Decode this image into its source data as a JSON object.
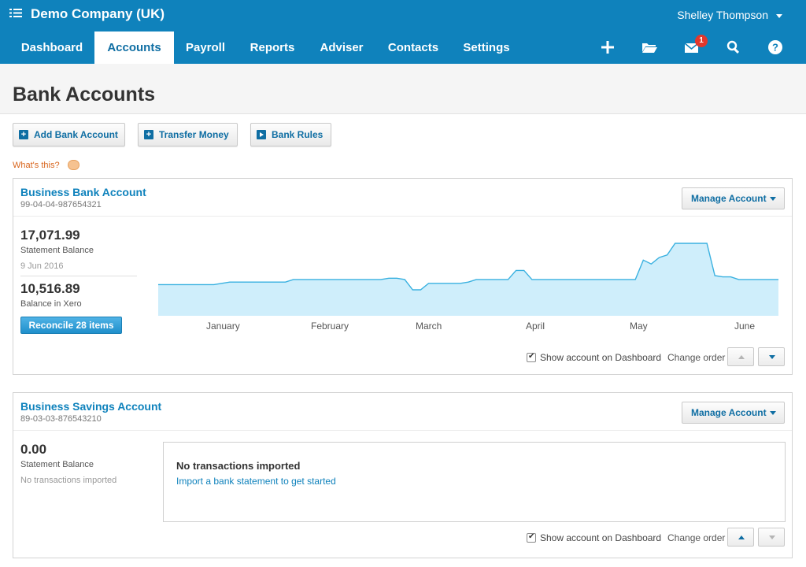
{
  "header": {
    "org_name": "Demo Company (UK)",
    "user_name": "Shelley Thompson",
    "notification_count": "1"
  },
  "nav": {
    "tabs": [
      {
        "label": "Dashboard",
        "active": false
      },
      {
        "label": "Accounts",
        "active": true
      },
      {
        "label": "Payroll",
        "active": false
      },
      {
        "label": "Reports",
        "active": false
      },
      {
        "label": "Adviser",
        "active": false
      },
      {
        "label": "Contacts",
        "active": false
      },
      {
        "label": "Settings",
        "active": false
      }
    ],
    "icons": [
      "plus-icon",
      "folder-icon",
      "mail-icon",
      "search-icon",
      "help-icon"
    ]
  },
  "page": {
    "title": "Bank Accounts",
    "actions": {
      "add_bank_account": "Add Bank Account",
      "transfer_money": "Transfer Money",
      "bank_rules": "Bank Rules"
    },
    "whats_this": "What's this?"
  },
  "accounts": [
    {
      "name": "Business Bank Account",
      "number": "99-04-04-987654321",
      "manage_label": "Manage Account",
      "statement_balance": "17,071.99",
      "statement_balance_label": "Statement Balance",
      "statement_date": "9 Jun 2016",
      "xero_balance": "10,516.89",
      "xero_balance_label": "Balance in Xero",
      "reconcile_label": "Reconcile 28 items",
      "show_on_dashboard": "Show account on Dashboard",
      "show_checked": true,
      "change_order": "Change order",
      "months": [
        "January",
        "February",
        "March",
        "April",
        "May",
        "June"
      ]
    },
    {
      "name": "Business Savings Account",
      "number": "89-03-03-876543210",
      "manage_label": "Manage Account",
      "statement_balance": "0.00",
      "statement_balance_label": "Statement Balance",
      "no_tx_label": "No transactions imported",
      "no_tx_title": "No transactions imported",
      "no_tx_link": "Import a bank statement to get started",
      "show_on_dashboard": "Show account on Dashboard",
      "show_checked": true,
      "change_order": "Change order"
    }
  ],
  "colors": {
    "brand_blue": "#0f82bc",
    "chart_fill": "#cfeefb",
    "chart_line": "#3ab1e0",
    "link_orange": "#d8631a"
  },
  "chart_data": {
    "type": "area",
    "title": "",
    "xlabel": "",
    "ylabel": "",
    "x_ticks": [
      "January",
      "February",
      "March",
      "April",
      "May",
      "June"
    ],
    "series": [
      {
        "values": [
          4,
          4,
          4,
          4,
          4,
          4,
          4,
          4,
          5,
          6,
          6,
          6,
          6,
          6,
          6,
          6,
          6,
          8,
          8,
          8,
          8,
          8,
          8,
          8,
          8,
          8,
          8,
          8,
          8,
          9,
          9,
          8,
          0,
          0,
          5,
          5,
          5,
          5,
          5,
          6,
          8,
          8,
          8,
          8,
          8,
          15,
          15,
          8,
          8,
          8,
          8,
          8,
          8,
          8,
          8,
          8,
          8,
          8,
          8,
          8,
          8,
          23,
          20,
          25,
          27,
          36,
          36,
          36,
          36,
          36,
          11,
          10,
          10,
          8,
          8,
          8,
          8,
          8,
          8
        ]
      }
    ],
    "grid": false,
    "legend": "none"
  }
}
